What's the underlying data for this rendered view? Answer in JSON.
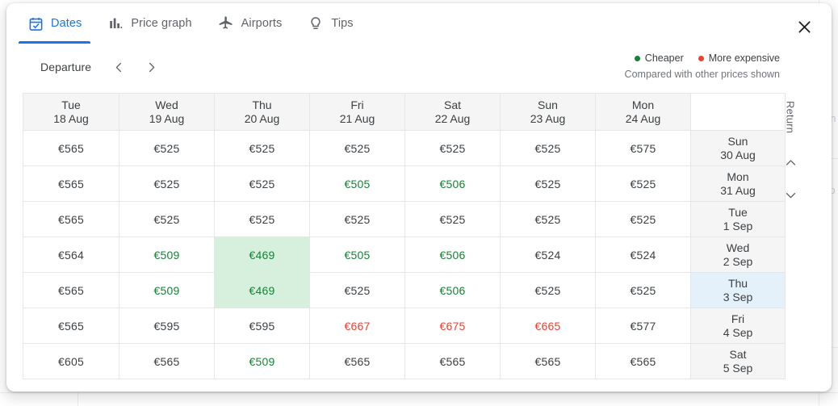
{
  "window": {
    "close_icon": "close-icon"
  },
  "tabs": [
    {
      "label": "Dates",
      "icon": "calendar-check-icon",
      "active": true
    },
    {
      "label": "Price graph",
      "icon": "bar-chart-icon",
      "active": false
    },
    {
      "label": "Airports",
      "icon": "airplane-icon",
      "active": false
    },
    {
      "label": "Tips",
      "icon": "lightbulb-icon",
      "active": false
    }
  ],
  "controls": {
    "departure_label": "Departure",
    "prev_icon": "chevron-left-icon",
    "next_icon": "chevron-right-icon"
  },
  "legend": {
    "cheaper_label": "Cheaper",
    "expensive_label": "More expensive",
    "note": "Compared with other prices shown",
    "cheaper_color": "#188038",
    "expensive_color": "#ea4335"
  },
  "return_rail": {
    "label": "Return",
    "up_icon": "chevron-up-icon",
    "down_icon": "chevron-down-icon"
  },
  "grid": {
    "corner": "",
    "columns": [
      {
        "weekday": "Tue",
        "date": "18 Aug"
      },
      {
        "weekday": "Wed",
        "date": "19 Aug"
      },
      {
        "weekday": "Thu",
        "date": "20 Aug"
      },
      {
        "weekday": "Fri",
        "date": "21 Aug"
      },
      {
        "weekday": "Sat",
        "date": "22 Aug"
      },
      {
        "weekday": "Sun",
        "date": "23 Aug"
      },
      {
        "weekday": "Mon",
        "date": "24 Aug"
      }
    ],
    "rows": [
      {
        "weekday": "Sun",
        "date": "30 Aug",
        "selected": false,
        "cells": [
          {
            "value": "€565",
            "state": "normal"
          },
          {
            "value": "€525",
            "state": "normal"
          },
          {
            "value": "€525",
            "state": "normal"
          },
          {
            "value": "€525",
            "state": "normal"
          },
          {
            "value": "€525",
            "state": "normal"
          },
          {
            "value": "€525",
            "state": "normal"
          },
          {
            "value": "€575",
            "state": "normal"
          }
        ]
      },
      {
        "weekday": "Mon",
        "date": "31 Aug",
        "selected": false,
        "cells": [
          {
            "value": "€565",
            "state": "normal"
          },
          {
            "value": "€525",
            "state": "normal"
          },
          {
            "value": "€525",
            "state": "normal"
          },
          {
            "value": "€505",
            "state": "cheap"
          },
          {
            "value": "€506",
            "state": "cheap"
          },
          {
            "value": "€525",
            "state": "normal"
          },
          {
            "value": "€525",
            "state": "normal"
          }
        ]
      },
      {
        "weekday": "Tue",
        "date": "1 Sep",
        "selected": false,
        "cells": [
          {
            "value": "€565",
            "state": "normal"
          },
          {
            "value": "€525",
            "state": "normal"
          },
          {
            "value": "€525",
            "state": "normal"
          },
          {
            "value": "€525",
            "state": "normal"
          },
          {
            "value": "€525",
            "state": "normal"
          },
          {
            "value": "€525",
            "state": "normal"
          },
          {
            "value": "€525",
            "state": "normal"
          }
        ]
      },
      {
        "weekday": "Wed",
        "date": "2 Sep",
        "selected": false,
        "cells": [
          {
            "value": "€564",
            "state": "normal"
          },
          {
            "value": "€509",
            "state": "cheap"
          },
          {
            "value": "€469",
            "state": "best"
          },
          {
            "value": "€505",
            "state": "cheap"
          },
          {
            "value": "€506",
            "state": "cheap"
          },
          {
            "value": "€524",
            "state": "normal"
          },
          {
            "value": "€524",
            "state": "normal"
          }
        ]
      },
      {
        "weekday": "Thu",
        "date": "3 Sep",
        "selected": true,
        "cells": [
          {
            "value": "€565",
            "state": "normal"
          },
          {
            "value": "€509",
            "state": "cheap"
          },
          {
            "value": "€469",
            "state": "best"
          },
          {
            "value": "€525",
            "state": "normal"
          },
          {
            "value": "€506",
            "state": "cheap"
          },
          {
            "value": "€525",
            "state": "normal"
          },
          {
            "value": "€525",
            "state": "normal"
          }
        ]
      },
      {
        "weekday": "Fri",
        "date": "4 Sep",
        "selected": false,
        "cells": [
          {
            "value": "€565",
            "state": "normal"
          },
          {
            "value": "€595",
            "state": "normal"
          },
          {
            "value": "€595",
            "state": "normal"
          },
          {
            "value": "€667",
            "state": "expensive"
          },
          {
            "value": "€675",
            "state": "expensive"
          },
          {
            "value": "€665",
            "state": "expensive"
          },
          {
            "value": "€577",
            "state": "normal"
          }
        ]
      },
      {
        "weekday": "Sat",
        "date": "5 Sep",
        "selected": false,
        "cells": [
          {
            "value": "€605",
            "state": "normal"
          },
          {
            "value": "€565",
            "state": "normal"
          },
          {
            "value": "€509",
            "state": "cheap"
          },
          {
            "value": "€565",
            "state": "normal"
          },
          {
            "value": "€565",
            "state": "normal"
          },
          {
            "value": "€565",
            "state": "normal"
          },
          {
            "value": "€565",
            "state": "normal"
          }
        ]
      }
    ]
  },
  "background": {
    "faint_text_1": "on",
    "faint_text_2": "rp"
  }
}
